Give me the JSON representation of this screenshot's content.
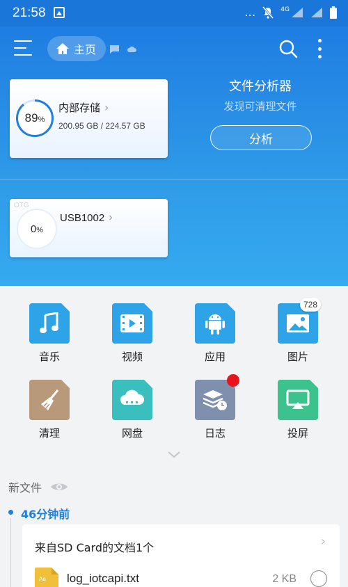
{
  "status_bar": {
    "time": "21:58",
    "network": "4G"
  },
  "toolbar": {
    "home_label": "主页"
  },
  "storage": {
    "internal": {
      "title": "内部存储",
      "percent": "89",
      "percent_unit": "%",
      "usage": "200.95 GB / 224.57 GB",
      "fraction": 0.89
    },
    "usb": {
      "tag": "OTG",
      "title": "USB1002",
      "percent": "0",
      "percent_unit": "%"
    }
  },
  "analyzer": {
    "title": "文件分析器",
    "subtitle": "发现可清理文件",
    "button": "分析"
  },
  "categories": [
    {
      "label": "音乐",
      "icon": "music-icon",
      "color": "#2ea3e8"
    },
    {
      "label": "视频",
      "icon": "video-icon",
      "color": "#2ea3e8"
    },
    {
      "label": "应用",
      "icon": "android-icon",
      "color": "#2ea3e8"
    },
    {
      "label": "图片",
      "icon": "image-icon",
      "color": "#2ea3e8",
      "badge": "728"
    },
    {
      "label": "清理",
      "icon": "broom-icon",
      "color": "#b89a7a"
    },
    {
      "label": "网盘",
      "icon": "cloud-icon",
      "color": "#3bbfbe"
    },
    {
      "label": "日志",
      "icon": "log-icon",
      "color": "#7f8fae"
    },
    {
      "label": "投屏",
      "icon": "cast-icon",
      "color": "#3cc38d"
    }
  ],
  "new_files": {
    "title": "新文件",
    "time": "46分钟前",
    "group_title": "来自SD Card的文档1个",
    "files": [
      {
        "name": "log_iotcapi.txt",
        "size": "2 KB",
        "icon_text": "Aa"
      }
    ]
  }
}
